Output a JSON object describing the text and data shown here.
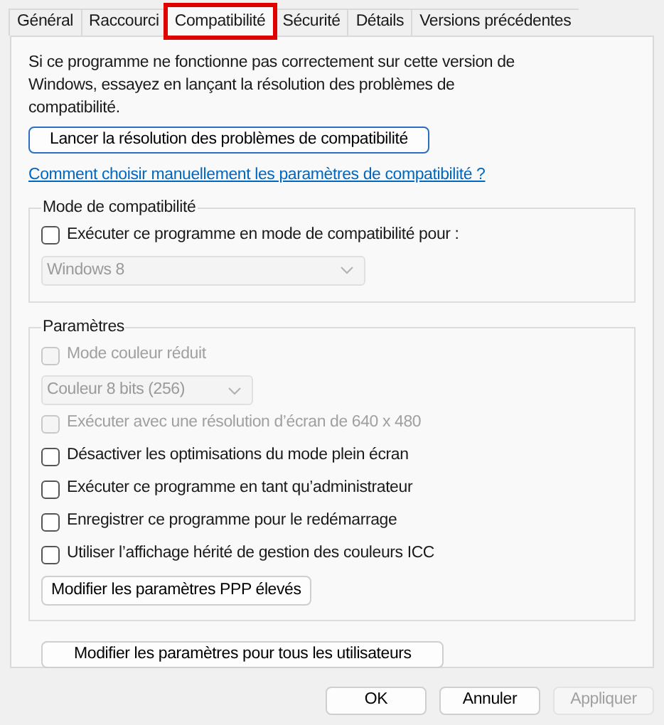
{
  "tabs": [
    {
      "label": "Général",
      "selected": false,
      "highlighted": false
    },
    {
      "label": "Raccourci",
      "selected": false,
      "highlighted": false
    },
    {
      "label": "Compatibilité",
      "selected": true,
      "highlighted": true
    },
    {
      "label": "Sécurité",
      "selected": false,
      "highlighted": false
    },
    {
      "label": "Détails",
      "selected": false,
      "highlighted": false
    },
    {
      "label": "Versions précédentes",
      "selected": false,
      "highlighted": false
    }
  ],
  "intro": "Si ce programme ne fonctionne pas correctement sur cette version de Windows, essayez en lançant la résolution des problèmes de compatibilité.",
  "troubleshoot_button": "Lancer la résolution des problèmes de compatibilité",
  "help_link": "Comment choisir manuellement les paramètres de compatibilité ?",
  "compat_mode": {
    "title": "Mode de compatibilité",
    "checkbox": {
      "label": "Exécuter ce programme en mode de compatibilité pour :",
      "checked": false,
      "disabled": false
    },
    "dropdown": {
      "value": "Windows 8",
      "disabled": true
    }
  },
  "settings": {
    "title": "Paramètres",
    "items": [
      {
        "kind": "checkbox",
        "label": "Mode couleur réduit",
        "checked": false,
        "disabled": true
      },
      {
        "kind": "dropdown",
        "value": "Couleur 8 bits (256)",
        "disabled": true
      },
      {
        "kind": "checkbox",
        "label": "Exécuter avec une résolution d’écran de 640 x 480",
        "checked": false,
        "disabled": true
      },
      {
        "kind": "checkbox",
        "label": "Désactiver les optimisations du mode plein écran",
        "checked": false,
        "disabled": false
      },
      {
        "kind": "checkbox",
        "label": "Exécuter ce programme en tant qu’administrateur",
        "checked": false,
        "disabled": false
      },
      {
        "kind": "checkbox",
        "label": "Enregistrer ce programme pour le redémarrage",
        "checked": false,
        "disabled": false
      },
      {
        "kind": "checkbox",
        "label": "Utiliser l’affichage hérité de gestion des couleurs ICC",
        "checked": false,
        "disabled": false
      },
      {
        "kind": "button",
        "label": "Modifier les paramètres PPP élevés",
        "disabled": false
      }
    ]
  },
  "all_users_button": "Modifier les paramètres pour tous les utilisateurs",
  "footer_buttons": [
    {
      "label": "OK",
      "disabled": false
    },
    {
      "label": "Annuler",
      "disabled": false
    },
    {
      "label": "Appliquer",
      "disabled": true
    }
  ]
}
